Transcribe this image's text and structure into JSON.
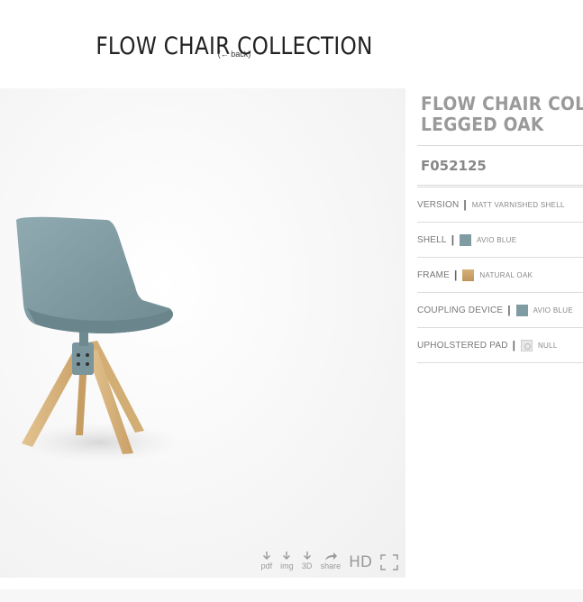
{
  "header": {
    "title": "FLOW CHAIR COLLECTION",
    "back_link": "(← back)"
  },
  "viewer": {
    "toolbar": {
      "pdf_label": "pdf",
      "img_label": "img",
      "threed_label": "3D",
      "share_label": "share",
      "hd_label": "HD"
    },
    "colors": {
      "shell": "#85a0a6",
      "wood": "#d9b683",
      "background": "#f3f3f3"
    }
  },
  "product": {
    "name": "FLOW CHAIR COL\nLEGGED OAK",
    "code": "F052125",
    "specs": [
      {
        "label": "VERSION",
        "value": "MATT VARNISHED SHELL",
        "swatch": null
      },
      {
        "label": "SHELL",
        "value": "AVIO BLUE",
        "swatch": "#7f9ca2"
      },
      {
        "label": "FRAME",
        "value": "NATURAL OAK",
        "swatch": "#c9a066"
      },
      {
        "label": "COUPLING DEVICE",
        "value": "AVIO BLUE",
        "swatch": "#7f9ca2"
      },
      {
        "label": "UPHOLSTERED PAD",
        "value": "NULL",
        "swatch": "null-icon"
      }
    ]
  }
}
